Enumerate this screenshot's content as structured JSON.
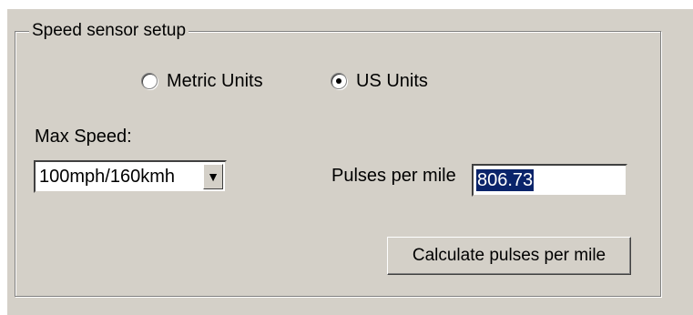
{
  "group": {
    "title": "Speed sensor setup"
  },
  "units": {
    "metric_label": "Metric Units",
    "us_label": "US Units",
    "selected": "us"
  },
  "max_speed": {
    "label": "Max Speed:",
    "selected_value": "100mph/160kmh",
    "arrow_icon": "▼"
  },
  "pulses": {
    "label": "Pulses per mile",
    "value": "806.73"
  },
  "calculate_button": {
    "label": "Calculate pulses per mile"
  }
}
